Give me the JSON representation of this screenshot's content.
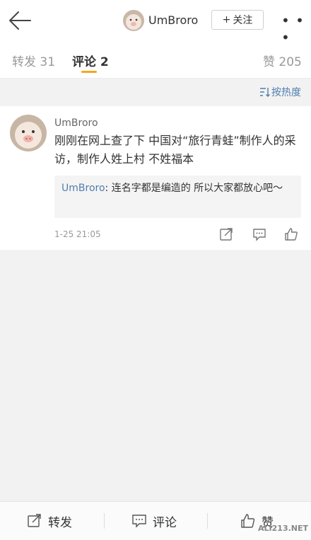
{
  "header": {
    "username": "UmBroro",
    "follow_label": "关注",
    "more_label": "• • •"
  },
  "tabs": [
    {
      "label": "转发 31"
    },
    {
      "label": "评论 2"
    },
    {
      "label": "赞 205"
    }
  ],
  "sort": {
    "label": "按热度"
  },
  "comment": {
    "username": "UmBroro",
    "text": "刚刚在网上查了下 中国对“旅行青蛙”制作人的采访，制作人姓上村  不姓福本",
    "reply_name": "UmBroro",
    "reply_sep": ":",
    "reply_text": " 连名字都是编造的 所以大家都放心吧～",
    "time": "1-25 21:05"
  },
  "bottom": {
    "forward_label": "转发",
    "comment_label": "评论",
    "like_label": "赞"
  },
  "watermark": "ALI213.NET"
}
